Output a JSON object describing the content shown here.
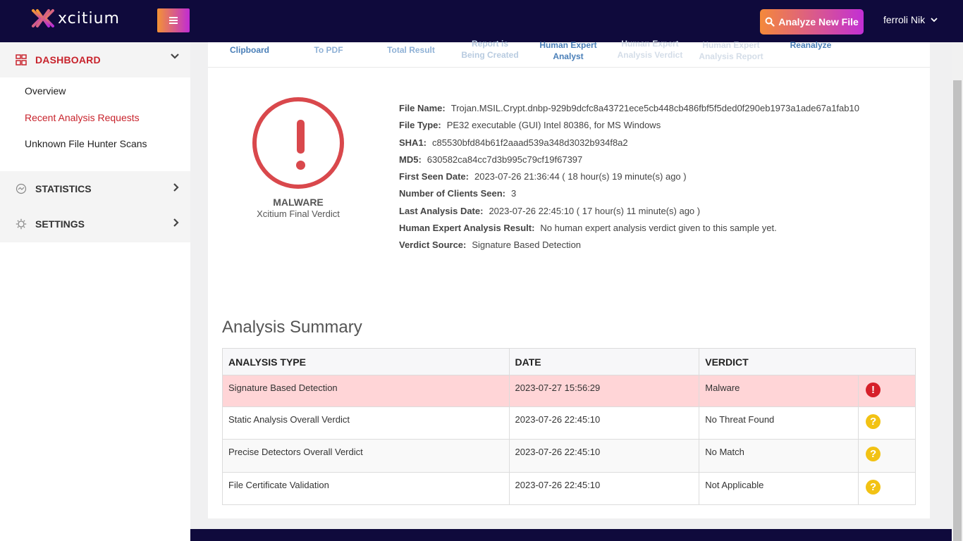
{
  "header": {
    "brand": "xcitium",
    "analyze_button": "Analyze New File",
    "user_name": "ferroli Nik"
  },
  "sidebar": {
    "dashboard": "DASHBOARD",
    "sub_items": [
      "Overview",
      "Recent Analysis Requests",
      "Unknown File Hunter Scans"
    ],
    "statistics": "STATISTICS",
    "settings": "SETTINGS"
  },
  "tabs": [
    {
      "line1": "Clipboard",
      "line2": ""
    },
    {
      "line1": "To PDF",
      "line2": ""
    },
    {
      "line1": "Total Result",
      "line2": ""
    },
    {
      "line1": "Report is",
      "line2": "Being Created"
    },
    {
      "line1": "Human Expert",
      "line2": "Analyst"
    },
    {
      "line1": "Human Expert",
      "line2": "Analysis Verdict"
    },
    {
      "line1": "Human Expert",
      "line2": "Analysis Report"
    },
    {
      "line1": "Reanalyze",
      "line2": ""
    }
  ],
  "verdict": {
    "label": "MALWARE",
    "sub": "Xcitium Final Verdict"
  },
  "details": [
    {
      "key": "File Name:",
      "value": "Trojan.MSIL.Crypt.dnbp-929b9dcfc8a43721ece5cb448cb486fbf5f5ded0f290eb1973a1ade67a1fab10"
    },
    {
      "key": "File Type:",
      "value": "PE32 executable (GUI) Intel 80386, for MS Windows"
    },
    {
      "key": "SHA1:",
      "value": "c85530bfd84b61f2aaad539a348d3032b934f8a2"
    },
    {
      "key": "MD5:",
      "value": "630582ca84cc7d3b995c79cf19f67397"
    },
    {
      "key": "First Seen Date:",
      "value": "2023-07-26 21:36:44 ( 18 hour(s) 19 minute(s) ago )"
    },
    {
      "key": "Number of Clients Seen:",
      "value": "3"
    },
    {
      "key": "Last Analysis Date:",
      "value": "2023-07-26 22:45:10 ( 17 hour(s) 11 minute(s) ago )"
    },
    {
      "key": "Human Expert Analysis Result:",
      "value": "No human expert analysis verdict given to this sample yet."
    },
    {
      "key": "Verdict Source:",
      "value": "Signature Based Detection"
    }
  ],
  "summary": {
    "title": "Analysis Summary",
    "columns": [
      "ANALYSIS TYPE",
      "DATE",
      "VERDICT"
    ],
    "rows": [
      {
        "type": "Signature Based Detection",
        "date": "2023-07-27 15:56:29",
        "verdict": "Malware",
        "icon": "!"
      },
      {
        "type": "Static Analysis Overall Verdict",
        "date": "2023-07-26 22:45:10",
        "verdict": "No Threat Found",
        "icon": "?"
      },
      {
        "type": "Precise Detectors Overall Verdict",
        "date": "2023-07-26 22:45:10",
        "verdict": "No Match",
        "icon": "?"
      },
      {
        "type": "File Certificate Validation",
        "date": "2023-07-26 22:45:10",
        "verdict": "Not Applicable",
        "icon": "?"
      }
    ]
  }
}
